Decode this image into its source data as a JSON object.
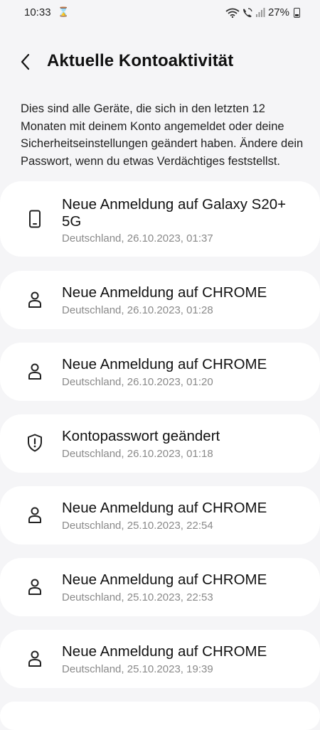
{
  "status": {
    "time": "10:33",
    "battery": "27%"
  },
  "header": {
    "title": "Aktuelle Kontoaktivität"
  },
  "intro": "Dies sind alle Geräte, die sich in den letzten 12 Monaten mit deinem Konto angemeldet oder deine Sicherheitseinstellungen geändert haben. Ändere dein Passwort, wenn du etwas Verdächtiges feststellst.",
  "activities": [
    {
      "icon": "phone-icon",
      "title": "Neue Anmeldung auf Galaxy S20+ 5G",
      "subtitle": "Deutschland, 26.10.2023, 01:37"
    },
    {
      "icon": "person-icon",
      "title": "Neue Anmeldung auf CHROME",
      "subtitle": "Deutschland, 26.10.2023, 01:28"
    },
    {
      "icon": "person-icon",
      "title": "Neue Anmeldung auf CHROME",
      "subtitle": "Deutschland, 26.10.2023, 01:20"
    },
    {
      "icon": "shield-icon",
      "title": "Kontopasswort geändert",
      "subtitle": "Deutschland, 26.10.2023, 01:18"
    },
    {
      "icon": "person-icon",
      "title": "Neue Anmeldung auf CHROME",
      "subtitle": "Deutschland, 25.10.2023, 22:54"
    },
    {
      "icon": "person-icon",
      "title": "Neue Anmeldung auf CHROME",
      "subtitle": "Deutschland, 25.10.2023, 22:53"
    },
    {
      "icon": "person-icon",
      "title": "Neue Anmeldung auf CHROME",
      "subtitle": "Deutschland, 25.10.2023, 19:39"
    }
  ]
}
